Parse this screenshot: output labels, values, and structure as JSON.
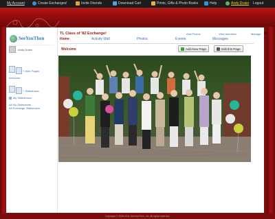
{
  "topbar": {
    "my_account": "My Account",
    "create_exchanges": "Create Exchanges!",
    "invite_friends": "Invite Friends",
    "download_cart": "Download Cart",
    "prints_gifts": "Prints, Gifts & Photo Books",
    "help": "Help",
    "user_name": "Andy Drake",
    "logout": "Logout"
  },
  "sidebar": {
    "logo_text": "SeeYouThen",
    "user_name": "Andy Drake",
    "web_pages": "+ Web Pages",
    "welcome": "Welcome",
    "slideshows_add": "+ Slideshows",
    "my_slideshows": "My Slideshows",
    "all_my_slideshows": "All My Slideshows",
    "all_exchange_slideshows": "All Exchange Slideshows"
  },
  "header": {
    "add_photos": "Add Photos",
    "view_members": "View members",
    "manage": "Manage",
    "group_title": "TL Class of '82 Exchange!"
  },
  "nav": {
    "tabs": [
      "Home",
      "Activity Wall",
      "Photos",
      "Events",
      "Messages"
    ],
    "active": "Home"
  },
  "page": {
    "section_title": "Welcome",
    "add_new_page": "Add New Page",
    "edit_this_page": "Edit this Page"
  },
  "footer": {
    "text": "Copyright © 2008-2011 SeeYouThen, Inc. All rights reserved."
  },
  "colors": {
    "brand_red": "#a31414",
    "link_blue": "#3a6fb0",
    "active_user": "#f6d21a"
  }
}
